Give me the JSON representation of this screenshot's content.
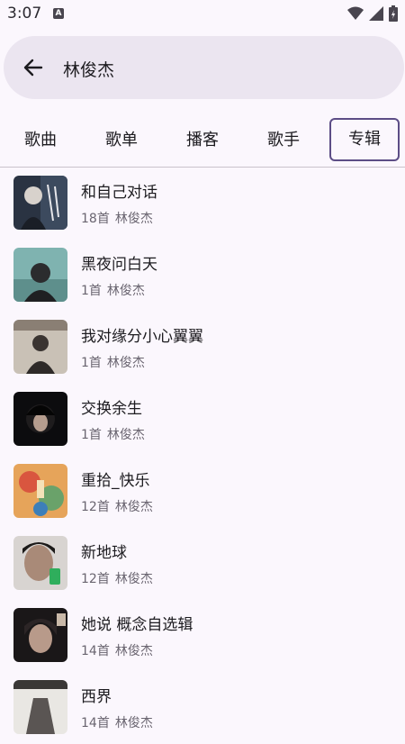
{
  "status": {
    "time": "3:07",
    "notif_icon": "A"
  },
  "search": {
    "query": "林俊杰"
  },
  "tabs": [
    {
      "label": "歌曲"
    },
    {
      "label": "歌单"
    },
    {
      "label": "播客"
    },
    {
      "label": "歌手"
    },
    {
      "label": "专辑"
    }
  ],
  "selected_tab": "专辑",
  "albums": [
    {
      "title": "和自己对话",
      "count": "18首",
      "artist": "林俊杰"
    },
    {
      "title": "黑夜问白天",
      "count": "1首",
      "artist": "林俊杰"
    },
    {
      "title": "我对缘分小心翼翼",
      "count": "1首",
      "artist": "林俊杰"
    },
    {
      "title": "交换余生",
      "count": "1首",
      "artist": "林俊杰"
    },
    {
      "title": "重拾_快乐",
      "count": "12首",
      "artist": "林俊杰"
    },
    {
      "title": "新地球",
      "count": "12首",
      "artist": "林俊杰"
    },
    {
      "title": "她说 概念自选辑",
      "count": "14首",
      "artist": "林俊杰"
    },
    {
      "title": "西界",
      "count": "14首",
      "artist": "林俊杰"
    }
  ]
}
